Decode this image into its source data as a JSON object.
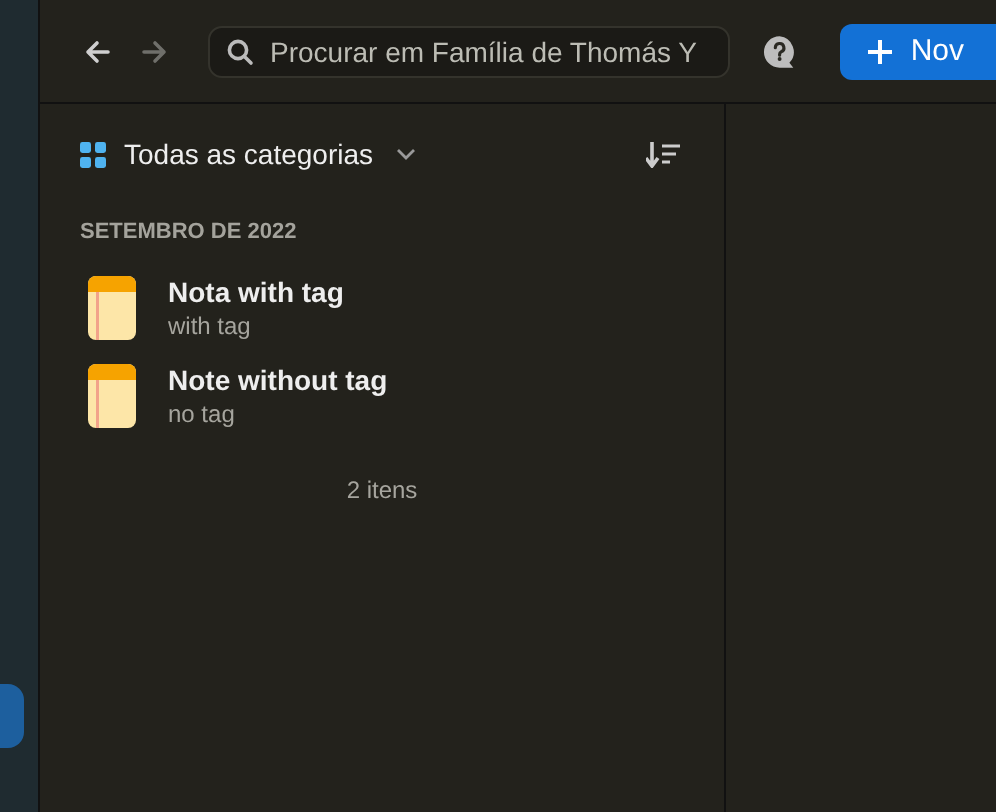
{
  "toolbar": {
    "nav": [
      {
        "kind": "back",
        "disabled": false
      },
      {
        "kind": "forward",
        "disabled": true
      }
    ],
    "search": {
      "placeholder": "Procurar em Família de Thomás Y"
    },
    "new_button": "Nov"
  },
  "list": {
    "category": "Todas as categorias",
    "section": "SETEMBRO DE 2022",
    "notes": [
      {
        "title": "Nota with tag",
        "subtitle": "with tag"
      },
      {
        "title": "Note without tag",
        "subtitle": "no tag"
      }
    ],
    "count": "2 itens"
  }
}
